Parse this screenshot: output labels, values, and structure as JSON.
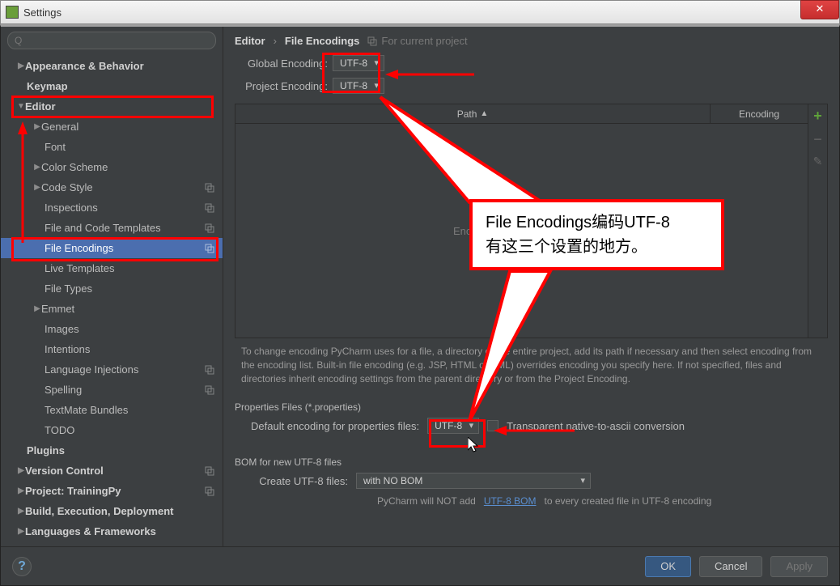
{
  "window": {
    "title": "Settings"
  },
  "search": {
    "placeholder": "Q"
  },
  "tree": {
    "appearance": "Appearance & Behavior",
    "keymap": "Keymap",
    "editor": "Editor",
    "general": "General",
    "font": "Font",
    "colorscheme": "Color Scheme",
    "codestyle": "Code Style",
    "inspections": "Inspections",
    "filecodetpl": "File and Code Templates",
    "fileencodings": "File Encodings",
    "livetpl": "Live Templates",
    "filetypes": "File Types",
    "emmet": "Emmet",
    "images": "Images",
    "intentions": "Intentions",
    "langinj": "Language Injections",
    "spelling": "Spelling",
    "textmate": "TextMate Bundles",
    "todo": "TODO",
    "plugins": "Plugins",
    "versioncontrol": "Version Control",
    "project": "Project: TrainingPy",
    "build": "Build, Execution, Deployment",
    "langframe": "Languages & Frameworks"
  },
  "breadcrumb": {
    "p1": "Editor",
    "p2": "File Encodings",
    "hint": "For current project"
  },
  "form": {
    "globalEncodingLabel": "Global Encoding:",
    "globalEncodingValue": "UTF-8",
    "projectEncodingLabel": "Project Encoding:",
    "projectEncodingValue": "UTF-8",
    "pathHeader": "Path",
    "encodingHeader": "Encoding",
    "tableEmpty": "Encodings are not configured",
    "helptext": "To change encoding PyCharm uses for a file, a directory or the entire project, add its path if necessary and then select encoding from the encoding list. Built-in file encoding (e.g. JSP, HTML or XML) overrides encoding you specify here. If not specified, files and directories inherit encoding settings from the parent directory or from the Project Encoding.",
    "propsSection": "Properties Files (*.properties)",
    "propsLabel": "Default encoding for properties files:",
    "propsValue": "UTF-8",
    "transparentLabel": "Transparent native-to-ascii conversion",
    "bomSection": "BOM for new UTF-8 files",
    "createLabel": "Create UTF-8 files:",
    "createValue": "with NO BOM",
    "bomInfo1": "PyCharm will NOT add ",
    "bomLink": "UTF-8 BOM",
    "bomInfo2": " to every created file in UTF-8 encoding"
  },
  "buttons": {
    "ok": "OK",
    "cancel": "Cancel",
    "apply": "Apply",
    "help": "?"
  },
  "callout": {
    "line1": "File  Encodings编码UTF-8",
    "line2": "有这三个设置的地方。"
  }
}
